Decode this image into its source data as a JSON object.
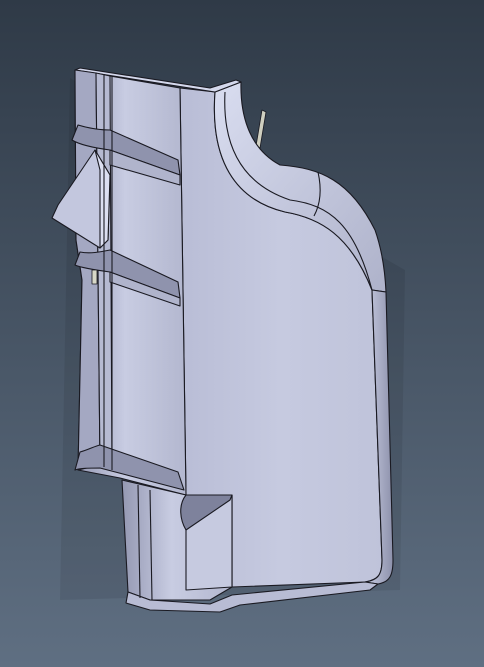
{
  "viewport": {
    "background_top": "#2f3a47",
    "background_bottom": "#5f6f82"
  },
  "model": {
    "face_color": "#c3c7de",
    "face_light": "#d7dbee",
    "face_shadow": "#8f93ad",
    "face_dark": "#6f7390",
    "edge_color": "#1a1a22",
    "pin_color": "#cfcfc0"
  }
}
